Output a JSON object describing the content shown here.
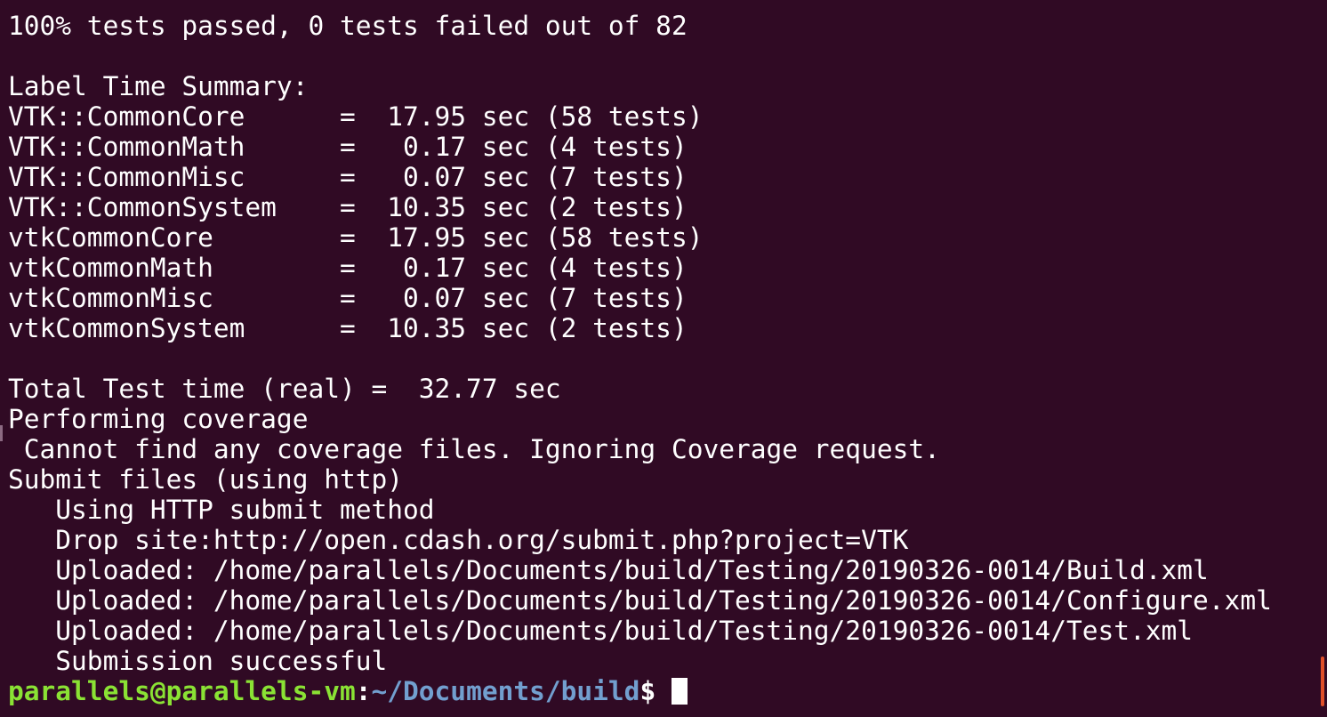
{
  "terminal": {
    "lines": [
      "100% tests passed, 0 tests failed out of 82",
      "",
      "Label Time Summary:",
      "VTK::CommonCore      =  17.95 sec (58 tests)",
      "VTK::CommonMath      =   0.17 sec (4 tests)",
      "VTK::CommonMisc      =   0.07 sec (7 tests)",
      "VTK::CommonSystem    =  10.35 sec (2 tests)",
      "vtkCommonCore        =  17.95 sec (58 tests)",
      "vtkCommonMath        =   0.17 sec (4 tests)",
      "vtkCommonMisc        =   0.07 sec (7 tests)",
      "vtkCommonSystem      =  10.35 sec (2 tests)",
      "",
      "Total Test time (real) =  32.77 sec",
      "Performing coverage",
      " Cannot find any coverage files. Ignoring Coverage request.",
      "Submit files (using http)",
      "   Using HTTP submit method",
      "   Drop site:http://open.cdash.org/submit.php?project=VTK",
      "   Uploaded: /home/parallels/Documents/build/Testing/20190326-0014/Build.xml",
      "   Uploaded: /home/parallels/Documents/build/Testing/20190326-0014/Configure.xml",
      "   Uploaded: /home/parallels/Documents/build/Testing/20190326-0014/Test.xml",
      "   Submission successful"
    ],
    "prompt": {
      "user_host": "parallels@parallels-vm",
      "separator": ":",
      "path": "~/Documents/build",
      "symbol": "$"
    },
    "colors": {
      "background": "#300a24",
      "text": "#ffffff",
      "user_host": "#8ae234",
      "path": "#729fcf",
      "scrollbar": "#e0502a"
    }
  }
}
